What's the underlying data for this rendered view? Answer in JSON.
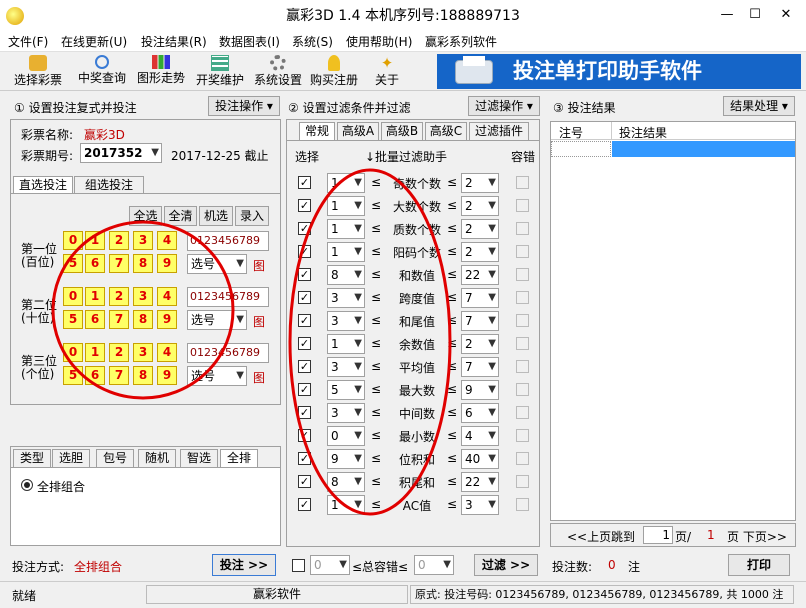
{
  "window": {
    "title": "赢彩3D 1.4  本机序列号:188889713",
    "minimize": "—",
    "maximize": "☐",
    "close": "✕"
  },
  "menu": [
    "文件(F)",
    "在线更新(U)",
    "投注结果(R)",
    "数据图表(I)",
    "系统(S)",
    "使用帮助(H)",
    "赢彩系列软件"
  ],
  "toolbar": [
    {
      "label": "选择彩票",
      "icon": "lottery-icon"
    },
    {
      "label": "中奖查询",
      "icon": "search-icon"
    },
    {
      "label": "图形走势",
      "icon": "chart-icon"
    },
    {
      "label": "开奖维护",
      "icon": "table-icon"
    },
    {
      "label": "系统设置",
      "icon": "gear-icon"
    },
    {
      "label": "购买注册",
      "icon": "key-icon"
    },
    {
      "label": "关于",
      "icon": "star-icon"
    }
  ],
  "banner": "投注单打印助手软件",
  "left": {
    "header": "① 设置投注复式并投注",
    "header_btn": "投注操作 ▾",
    "lottery_label": "彩票名称:",
    "lottery_value": "赢彩3D",
    "issue_label": "彩票期号:",
    "issue_value": "2017352",
    "date": "2017-12-25  截止",
    "tabs": [
      "直选投注",
      "组选投注"
    ],
    "buttons": [
      "全选",
      "全清",
      "机选",
      "录入"
    ],
    "positions": [
      {
        "label1": "第一位",
        "label2": "(百位)",
        "row1": [
          "0",
          "1",
          "2",
          "3",
          "4"
        ],
        "row2": [
          "5",
          "6",
          "7",
          "8",
          "9"
        ],
        "digits": "0123456789",
        "select": "选号",
        "chart": "图"
      },
      {
        "label1": "第二位",
        "label2": "(十位)",
        "row1": [
          "0",
          "1",
          "2",
          "3",
          "4"
        ],
        "row2": [
          "5",
          "6",
          "7",
          "8",
          "9"
        ],
        "digits": "0123456789",
        "select": "选号",
        "chart": "图"
      },
      {
        "label1": "第三位",
        "label2": "(个位)",
        "row1": [
          "0",
          "1",
          "2",
          "3",
          "4"
        ],
        "row2": [
          "5",
          "6",
          "7",
          "8",
          "9"
        ],
        "digits": "0123456789",
        "select": "选号",
        "chart": "图"
      }
    ],
    "bottom_tabs": [
      "类型",
      "选胆",
      "包号",
      "随机",
      "智选",
      "全排"
    ],
    "radio": "全排组合",
    "mode_label": "投注方式:",
    "mode_value": "全排组合",
    "submit": "投注 >>"
  },
  "middle": {
    "header": "② 设置过滤条件并过滤",
    "header_btn": "过滤操作 ▾",
    "tabs": [
      "常规",
      "高级A",
      "高级B",
      "高级C",
      "过滤插件"
    ],
    "col_select": "选择",
    "col_batch": "↓批量过滤助手",
    "col_tolerance": "容错",
    "rows": [
      {
        "min": "1",
        "name": "奇数个数",
        "max": "2"
      },
      {
        "min": "1",
        "name": "大数个数",
        "max": "2"
      },
      {
        "min": "1",
        "name": "质数个数",
        "max": "2"
      },
      {
        "min": "1",
        "name": "阳码个数",
        "max": "2"
      },
      {
        "min": "8",
        "name": "和数值",
        "max": "22"
      },
      {
        "min": "3",
        "name": "跨度值",
        "max": "7"
      },
      {
        "min": "3",
        "name": "和尾值",
        "max": "7"
      },
      {
        "min": "1",
        "name": "余数值",
        "max": "2"
      },
      {
        "min": "3",
        "name": "平均值",
        "max": "7"
      },
      {
        "min": "5",
        "name": "最大数",
        "max": "9"
      },
      {
        "min": "3",
        "name": "中间数",
        "max": "6"
      },
      {
        "min": "0",
        "name": "最小数",
        "max": "4"
      },
      {
        "min": "9",
        "name": "位积和",
        "max": "40"
      },
      {
        "min": "8",
        "name": "积尾和",
        "max": "22"
      },
      {
        "min": "1",
        "name": "AC值",
        "max": "3"
      }
    ],
    "le": "≤",
    "footer_min": "0",
    "footer_label": "≤总容错≤",
    "footer_max": "0",
    "filter_btn": "过滤 >>"
  },
  "right": {
    "header": "③ 投注结果",
    "header_btn": "结果处理 ▾",
    "col_no": "注号",
    "col_result": "投注结果",
    "prev": "<<上页",
    "jump": "跳到",
    "page": "1",
    "page_sep": "页/",
    "total_pages": "1",
    "next": "页 下页>>",
    "count_label": "投注数:",
    "count": "0",
    "count_unit": "注",
    "print": "打印"
  },
  "status": {
    "ready": "就绪",
    "app": "赢彩软件",
    "info": "原式: 投注号码: 0123456789, 0123456789, 0123456789, 共 1000 注"
  },
  "annotation_color": "#e00000"
}
